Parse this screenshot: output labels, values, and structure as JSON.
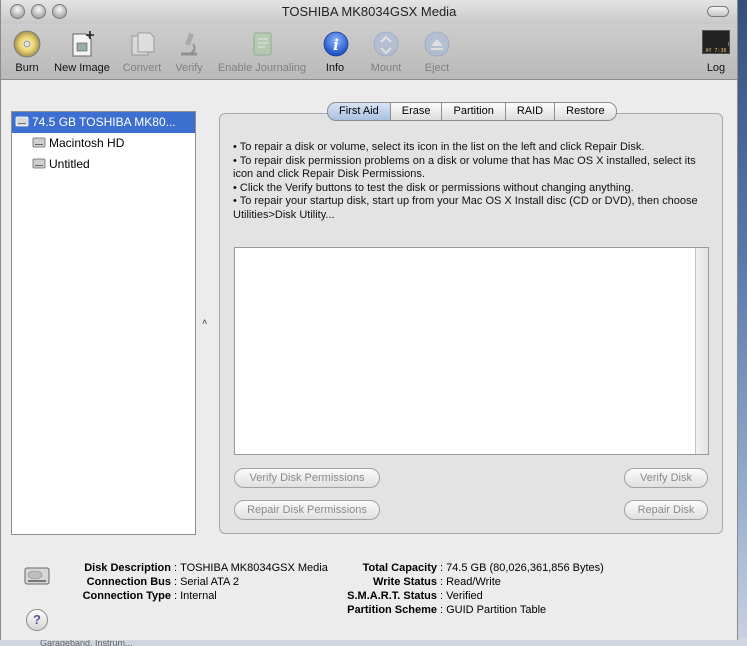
{
  "window": {
    "title": "TOSHIBA MK8034GSX Media"
  },
  "toolbar": {
    "items": [
      {
        "label": "Burn",
        "icon": "burn-icon",
        "enabled": true
      },
      {
        "label": "New Image",
        "icon": "new-image-icon",
        "enabled": true
      },
      {
        "label": "Convert",
        "icon": "convert-icon",
        "enabled": false
      },
      {
        "label": "Verify",
        "icon": "verify-icon",
        "enabled": false
      },
      {
        "label": "Enable Journaling",
        "icon": "enable-journaling-icon",
        "enabled": false
      },
      {
        "label": "Info",
        "icon": "info-icon",
        "enabled": true
      },
      {
        "label": "Mount",
        "icon": "mount-icon",
        "enabled": false
      },
      {
        "label": "Eject",
        "icon": "eject-icon",
        "enabled": false
      },
      {
        "label": "Log",
        "icon": "log-icon",
        "enabled": true
      }
    ],
    "log_icon_text": "WARNIN\nAY 7:36"
  },
  "disks": [
    {
      "label": "74.5 GB TOSHIBA MK80...",
      "selected": true,
      "level": 0
    },
    {
      "label": "Macintosh HD",
      "selected": false,
      "level": 1
    },
    {
      "label": "Untitled",
      "selected": false,
      "level": 1
    }
  ],
  "tabs": [
    {
      "label": "First Aid",
      "active": true
    },
    {
      "label": "Erase",
      "active": false
    },
    {
      "label": "Partition",
      "active": false
    },
    {
      "label": "RAID",
      "active": false
    },
    {
      "label": "Restore",
      "active": false
    }
  ],
  "first_aid": {
    "instructions": [
      "• To repair a disk or volume, select its icon in the list on the left and click Repair Disk.",
      "• To repair disk permission problems on a disk or volume that has Mac OS X installed, select its icon and click Repair Disk Permissions.",
      "• Click the Verify buttons to test the disk or permissions without changing anything.",
      "• To repair your startup disk, start up from your Mac OS X Install disc (CD or DVD), then choose Utilities>Disk Utility..."
    ],
    "buttons": {
      "verify_permissions": "Verify Disk Permissions",
      "verify_disk": "Verify Disk",
      "repair_permissions": "Repair Disk Permissions",
      "repair_disk": "Repair Disk"
    }
  },
  "info": {
    "left": [
      {
        "key": "Disk Description",
        "value": "TOSHIBA MK8034GSX Media"
      },
      {
        "key": "Connection Bus",
        "value": "Serial ATA 2"
      },
      {
        "key": "Connection Type",
        "value": "Internal"
      }
    ],
    "right": [
      {
        "key": "Total Capacity",
        "value": "74.5 GB (80,026,361,856 Bytes)"
      },
      {
        "key": "Write Status",
        "value": "Read/Write"
      },
      {
        "key": "S.M.A.R.T. Status",
        "value": "Verified"
      },
      {
        "key": "Partition Scheme",
        "value": "GUID Partition Table"
      }
    ],
    "help_label": "?"
  },
  "background": {
    "behind_text": "Garageband. Instrum..."
  }
}
